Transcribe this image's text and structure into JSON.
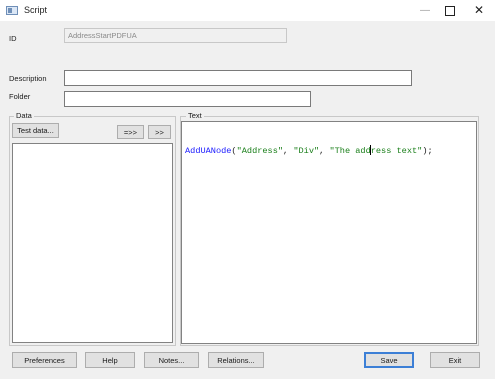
{
  "window": {
    "title": "Script",
    "icon": "script-window-icon",
    "controls": {
      "minimize": "—",
      "maximize": "□",
      "close": "✕"
    }
  },
  "form": {
    "id_label": "ID",
    "id_value": "AddressStartPDFUA",
    "description_label": "Description",
    "description_value": "",
    "folder_label": "Folder",
    "folder_value": ""
  },
  "data_panel": {
    "title": "Data",
    "test_data_button": "Test data...",
    "arrow_double_button": "=>>",
    "arrow_button": ">>",
    "items": []
  },
  "text_panel": {
    "title": "Text",
    "code": {
      "function": "AddUANode",
      "open": "(",
      "arg1": "\"Address\"",
      "sep": ", ",
      "arg2": "\"Div\"",
      "arg3_before_caret": "\"The add",
      "arg3_after_caret": "ress text\"",
      "close": ");"
    }
  },
  "footer": {
    "preferences": "Preferences",
    "help": "Help",
    "notes": "Notes...",
    "relations": "Relations...",
    "save": "Save",
    "exit": "Exit"
  }
}
